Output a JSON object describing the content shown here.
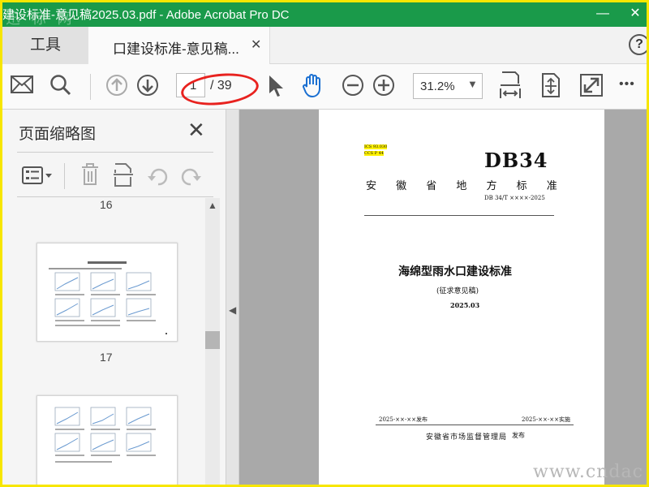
{
  "window": {
    "title": "建设标准-意见稿2025.03.pdf - Adobe Acrobat Pro DC",
    "watermark_top": "迅 标 网",
    "minimize_label": "—",
    "close_label": "✕"
  },
  "tabs": {
    "tools_label": "工具",
    "doc_label": "口建设标准-意见稿...",
    "doc_close": "✕",
    "help": "?"
  },
  "toolbar": {
    "page_current": "1",
    "page_total": "/ 39",
    "zoom": "31.2%",
    "zoom_arrow": "▼",
    "more": "•••"
  },
  "panel": {
    "title": "页面缩略图",
    "close": "✕",
    "thumbnails": [
      {
        "label": "16"
      },
      {
        "label": "17"
      }
    ]
  },
  "document": {
    "ics": "ICS 93.030",
    "ccs": "CCS P 44",
    "code": "DB34",
    "province": "安 徽 省 地 方 标 准",
    "number": "DB 34/T ××××-2025",
    "title": "海绵型雨水口建设标准",
    "subtitle": "(征求意见稿)",
    "date": "2025.03",
    "publish": "2025-××-××发布",
    "implement": "2025-××-××实施",
    "issuer": "安徽省市场监督管理局",
    "issuer_suffix": "发布"
  },
  "watermark_bottom": "www.cndac",
  "colors": {
    "titlebar": "#1a9a4a",
    "frame": "#f7e600",
    "annotation": "#e8221f",
    "highlight": "#fff200"
  }
}
